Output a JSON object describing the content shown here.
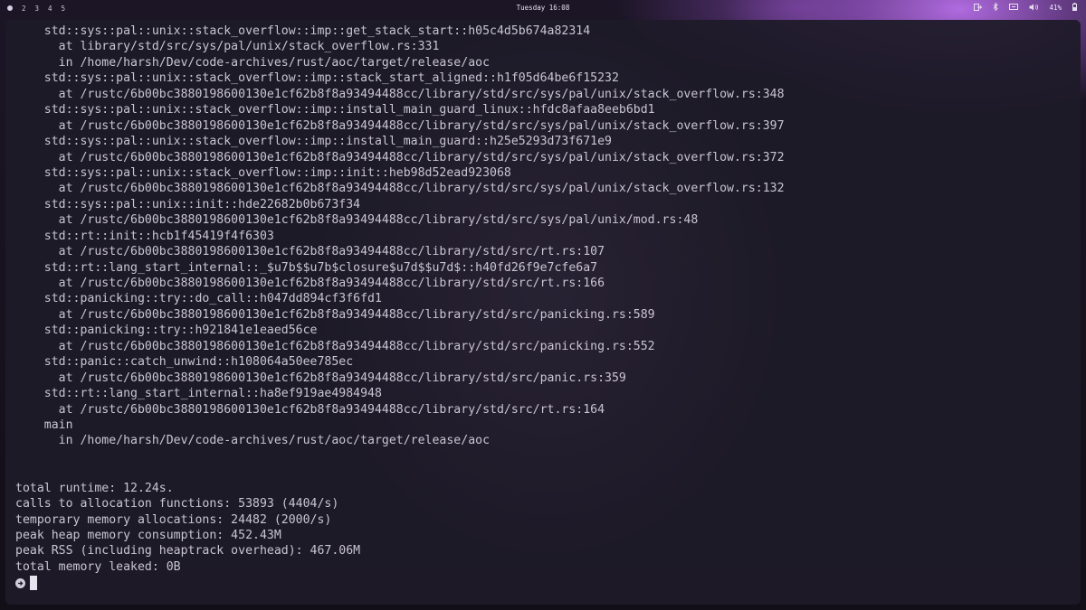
{
  "topbar": {
    "workspaces": [
      "2",
      "3",
      "4",
      "5"
    ],
    "clock": "Tuesday 16:08",
    "battery": "41%"
  },
  "terminal": {
    "lines": [
      "    std::sys::pal::unix::stack_overflow::imp::get_stack_start::h05c4d5b674a82314",
      "      at library/std/src/sys/pal/unix/stack_overflow.rs:331",
      "      in /home/harsh/Dev/code-archives/rust/aoc/target/release/aoc",
      "    std::sys::pal::unix::stack_overflow::imp::stack_start_aligned::h1f05d64be6f15232",
      "      at /rustc/6b00bc3880198600130e1cf62b8f8a93494488cc/library/std/src/sys/pal/unix/stack_overflow.rs:348",
      "    std::sys::pal::unix::stack_overflow::imp::install_main_guard_linux::hfdc8afaa8eeb6bd1",
      "      at /rustc/6b00bc3880198600130e1cf62b8f8a93494488cc/library/std/src/sys/pal/unix/stack_overflow.rs:397",
      "    std::sys::pal::unix::stack_overflow::imp::install_main_guard::h25e5293d73f671e9",
      "      at /rustc/6b00bc3880198600130e1cf62b8f8a93494488cc/library/std/src/sys/pal/unix/stack_overflow.rs:372",
      "    std::sys::pal::unix::stack_overflow::imp::init::heb98d52ead923068",
      "      at /rustc/6b00bc3880198600130e1cf62b8f8a93494488cc/library/std/src/sys/pal/unix/stack_overflow.rs:132",
      "    std::sys::pal::unix::init::hde22682b0b673f34",
      "      at /rustc/6b00bc3880198600130e1cf62b8f8a93494488cc/library/std/src/sys/pal/unix/mod.rs:48",
      "    std::rt::init::hcb1f45419f4f6303",
      "      at /rustc/6b00bc3880198600130e1cf62b8f8a93494488cc/library/std/src/rt.rs:107",
      "    std::rt::lang_start_internal::_$u7b$$u7b$closure$u7d$$u7d$::h40fd26f9e7cfe6a7",
      "      at /rustc/6b00bc3880198600130e1cf62b8f8a93494488cc/library/std/src/rt.rs:166",
      "    std::panicking::try::do_call::h047dd894cf3f6fd1",
      "      at /rustc/6b00bc3880198600130e1cf62b8f8a93494488cc/library/std/src/panicking.rs:589",
      "    std::panicking::try::h921841e1eaed56ce",
      "      at /rustc/6b00bc3880198600130e1cf62b8f8a93494488cc/library/std/src/panicking.rs:552",
      "    std::panic::catch_unwind::h108064a50ee785ec",
      "      at /rustc/6b00bc3880198600130e1cf62b8f8a93494488cc/library/std/src/panic.rs:359",
      "    std::rt::lang_start_internal::ha8ef919ae4984948",
      "      at /rustc/6b00bc3880198600130e1cf62b8f8a93494488cc/library/std/src/rt.rs:164",
      "    main",
      "      in /home/harsh/Dev/code-archives/rust/aoc/target/release/aoc",
      "",
      "",
      "total runtime: 12.24s.",
      "calls to allocation functions: 53893 (4404/s)",
      "temporary memory allocations: 24482 (2000/s)",
      "peak heap memory consumption: 452.43M",
      "peak RSS (including heaptrack overhead): 467.06M",
      "total memory leaked: 0B"
    ]
  }
}
